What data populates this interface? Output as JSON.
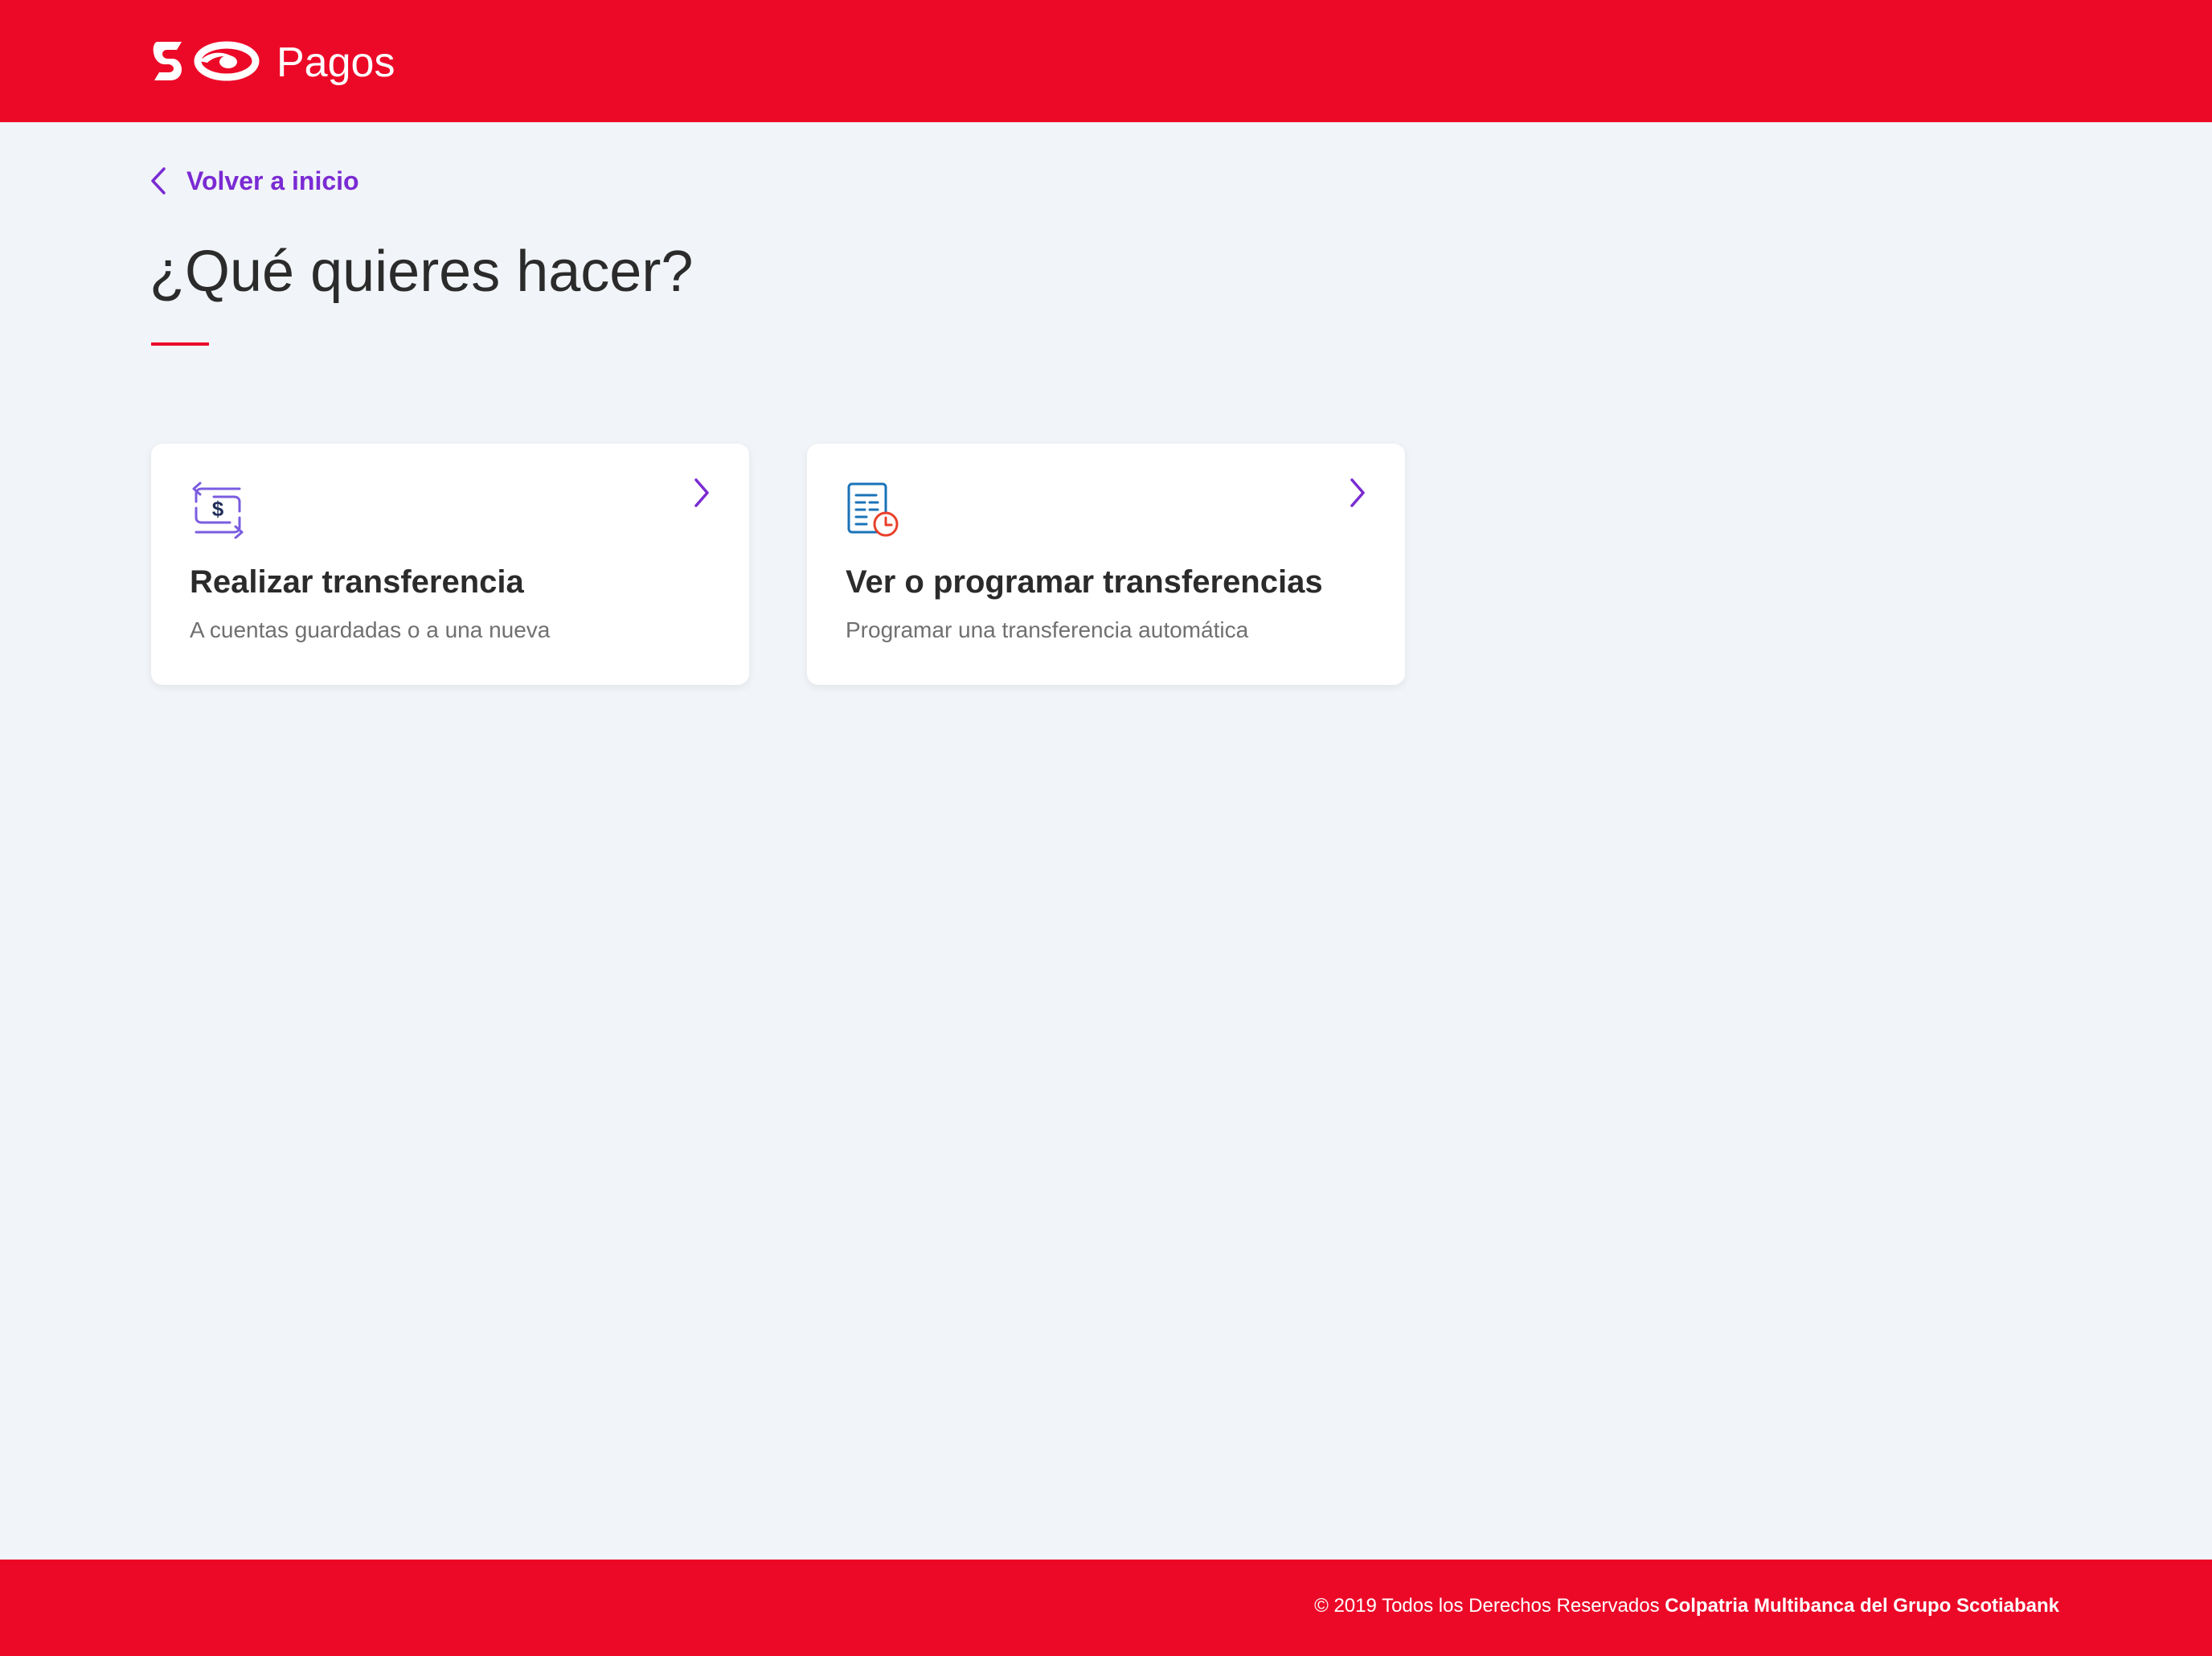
{
  "header": {
    "logo_icon": "scotiabank-logo",
    "title": "Pagos",
    "background_color": "#ec0928"
  },
  "nav": {
    "back_icon": "chevron-left-icon",
    "back_label": "Volver a inicio",
    "link_color": "#7a2bd3"
  },
  "main": {
    "title": "¿Qué quieres hacer?",
    "options": [
      {
        "icon": "transfer-money-icon",
        "title": "Realizar transferencia",
        "subtitle": "A cuentas guardadas o a una nueva"
      },
      {
        "icon": "scheduled-document-icon",
        "title": "Ver o programar transferencias",
        "subtitle": "Programar una transferencia automática"
      }
    ]
  },
  "footer": {
    "copyright": "© 2019 Todos los Derechos Reservados",
    "company": "Colpatria Multibanca del Grupo Scotiabank"
  }
}
